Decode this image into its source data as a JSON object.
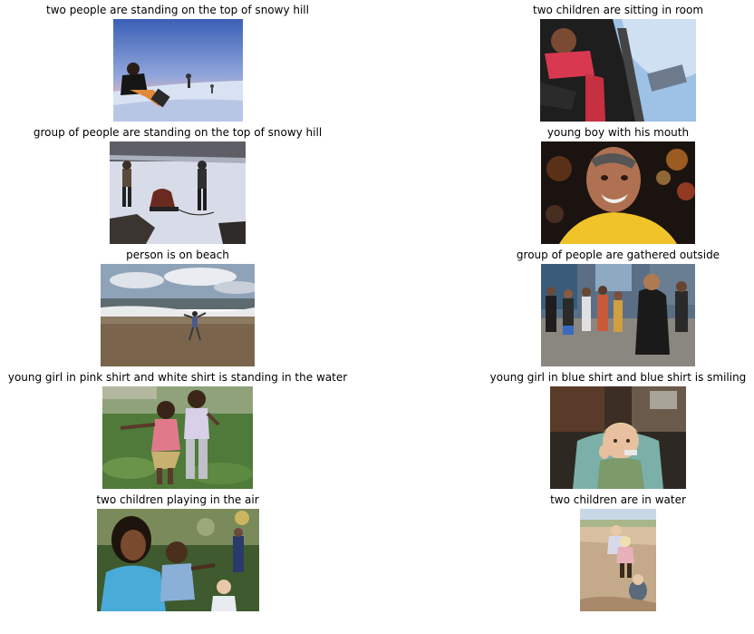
{
  "items": [
    {
      "caption": "two people are standing on the top of snowy hill",
      "scene": "snowboarder-sitting-on-snow-slope-at-dusk"
    },
    {
      "caption": "two children are sitting in room",
      "scene": "person-leaning-out-of-car-window"
    },
    {
      "caption": "group of people are standing on the top of snowy hill",
      "scene": "people-with-sled-on-snowy-field"
    },
    {
      "caption": "young boy with his mouth",
      "scene": "smiling-man-in-yellow-shirt-night-lights"
    },
    {
      "caption": "person is on beach",
      "scene": "person-dancing-on-beach-with-waves"
    },
    {
      "caption": "group of people are gathered outside",
      "scene": "crowd-walking-on-city-street"
    },
    {
      "caption": "young girl in pink shirt and white shirt is standing in the water",
      "scene": "two-girls-playing-on-grass"
    },
    {
      "caption": "young girl in blue shirt and blue shirt is smiling",
      "scene": "blond-toddler-eating-in-chair"
    },
    {
      "caption": "two children playing in the air",
      "scene": "woman-and-children-in-park"
    },
    {
      "caption": "two children are in water",
      "scene": "children-on-sandy-beach"
    }
  ]
}
